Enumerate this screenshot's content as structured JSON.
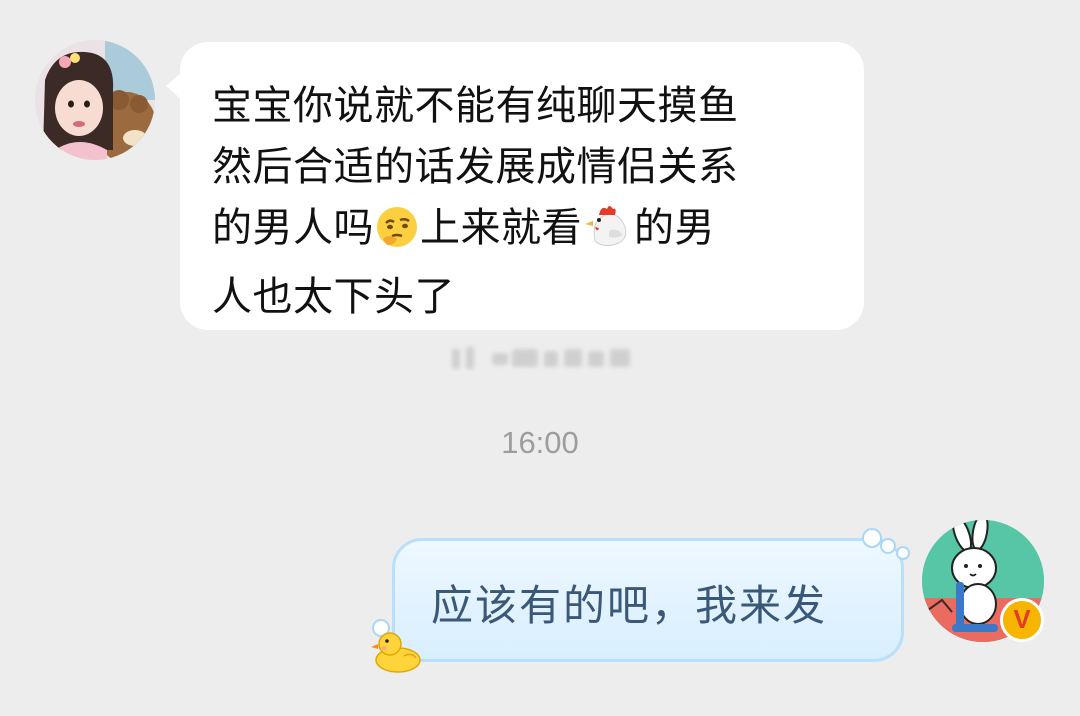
{
  "incoming_message": {
    "lines": [
      "宝宝你说就不能有纯聊天摸鱼",
      "然后合适的话发展成情侣关系",
      "的男人吗",
      "上来就看",
      "的男",
      "人也太下头了"
    ],
    "emojis": [
      "thinking-face-icon",
      "chicken-icon"
    ]
  },
  "timestamp": "16:00",
  "outgoing_message": {
    "text": "应该有的吧，我来发"
  },
  "colors": {
    "background": "#ededed",
    "incoming_bubble": "#ffffff",
    "outgoing_bubble": "#e1f2ff",
    "outgoing_border": "#b8dffb",
    "outgoing_text": "#3a5878",
    "timestamp_text": "#9d9d9d",
    "verified_badge": "#f7b500"
  },
  "badge": {
    "label": "V"
  }
}
